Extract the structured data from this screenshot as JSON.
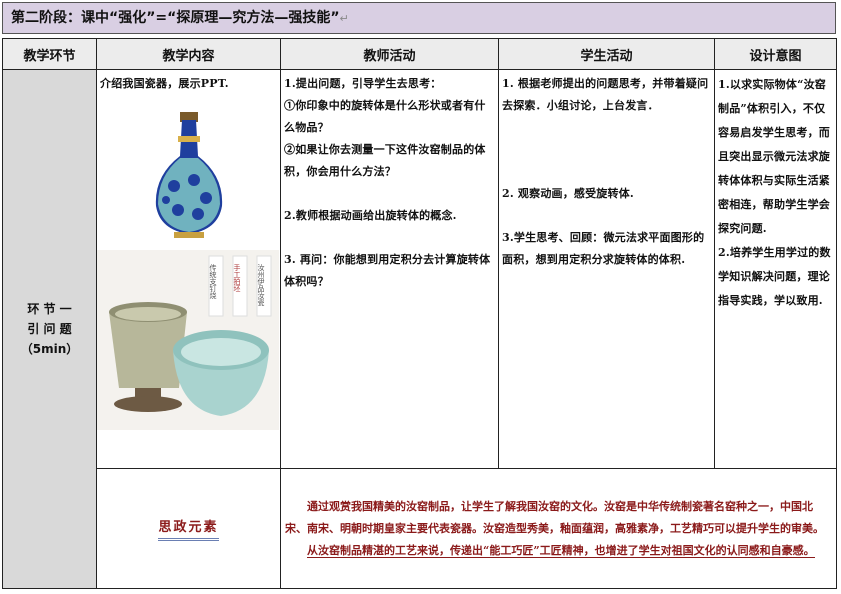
{
  "stage": {
    "title": "第二阶段：课中“强化”=“探原理—究方法—强技能”"
  },
  "headers": {
    "segment": "教学环节",
    "content": "教学内容",
    "teacher": "教师活动",
    "student": "学生活动",
    "intent": "设计意图"
  },
  "segment": {
    "line1": "环 节 一",
    "line2": "引 问 题",
    "line3": "（5min）"
  },
  "content": {
    "intro": "介绍我国瓷器，展示PPT.",
    "cup_caption_1": "汝州伊品汝瓷",
    "cup_caption_2": "手工拍坯",
    "cup_caption_3": "传统支钉烧"
  },
  "teacher": {
    "p1": "1.提出问题，引导学生去思考：",
    "p2": "①你印象中的旋转体是什么形状或者有什么物品？",
    "p3": "②如果让你去测量一下这件汝窑制品的体积，你会用什么方法？",
    "p4": "2.教师根据动画给出旋转体的概念.",
    "p5": "3. 再问：你能想到用定积分去计算旋转体体积吗？"
  },
  "student": {
    "p1": "1. 根据老师提出的问题思考，并带着疑问去探索．小组讨论，上台发言．",
    "p2": "2. 观察动画，感受旋转体.",
    "p3": "3.学生思考、回顾：微元法求平面图形的面积，想到用定积分求旋转体的体积."
  },
  "intent": {
    "p1": "1.以求实际物体“汝窑制品”体积引入，不仅容易启发学生思考，而且突出显示微元法求旋转体体积与实际生活紧密相连，帮助学生学会探究问题.",
    "p2": "2.培养学生用学过的数学知识解决问题，理论指导实践，学以致用."
  },
  "sizheng": {
    "title": "思政元素",
    "p1": "通过观赏我国精美的汝窑制品，让学生了解我国汝窑的文化。汝窑是中华传统制瓷著名窑种之一，中国北宋、南宋、明朝时期皇家主要代表瓷器。汝窑造型秀美，釉面蕴润，高雅素净，工艺精巧可以提升学生的审美。",
    "p2": "从汝窑制品精湛的工艺来说，传递出“能工巧匠”工匠精神，也增进了学生对祖国文化的认同感和自豪感。"
  },
  "colors": {
    "stage_bg": "#d9cfe3",
    "header_bg": "#ececec",
    "segment_bg": "#d9d9d9",
    "sizheng_text": "#8b1a1a",
    "vase_blue": "#1f3f9e",
    "celadon": "#a9d3cf"
  },
  "icons": {
    "paragraph_mark": "↵"
  }
}
